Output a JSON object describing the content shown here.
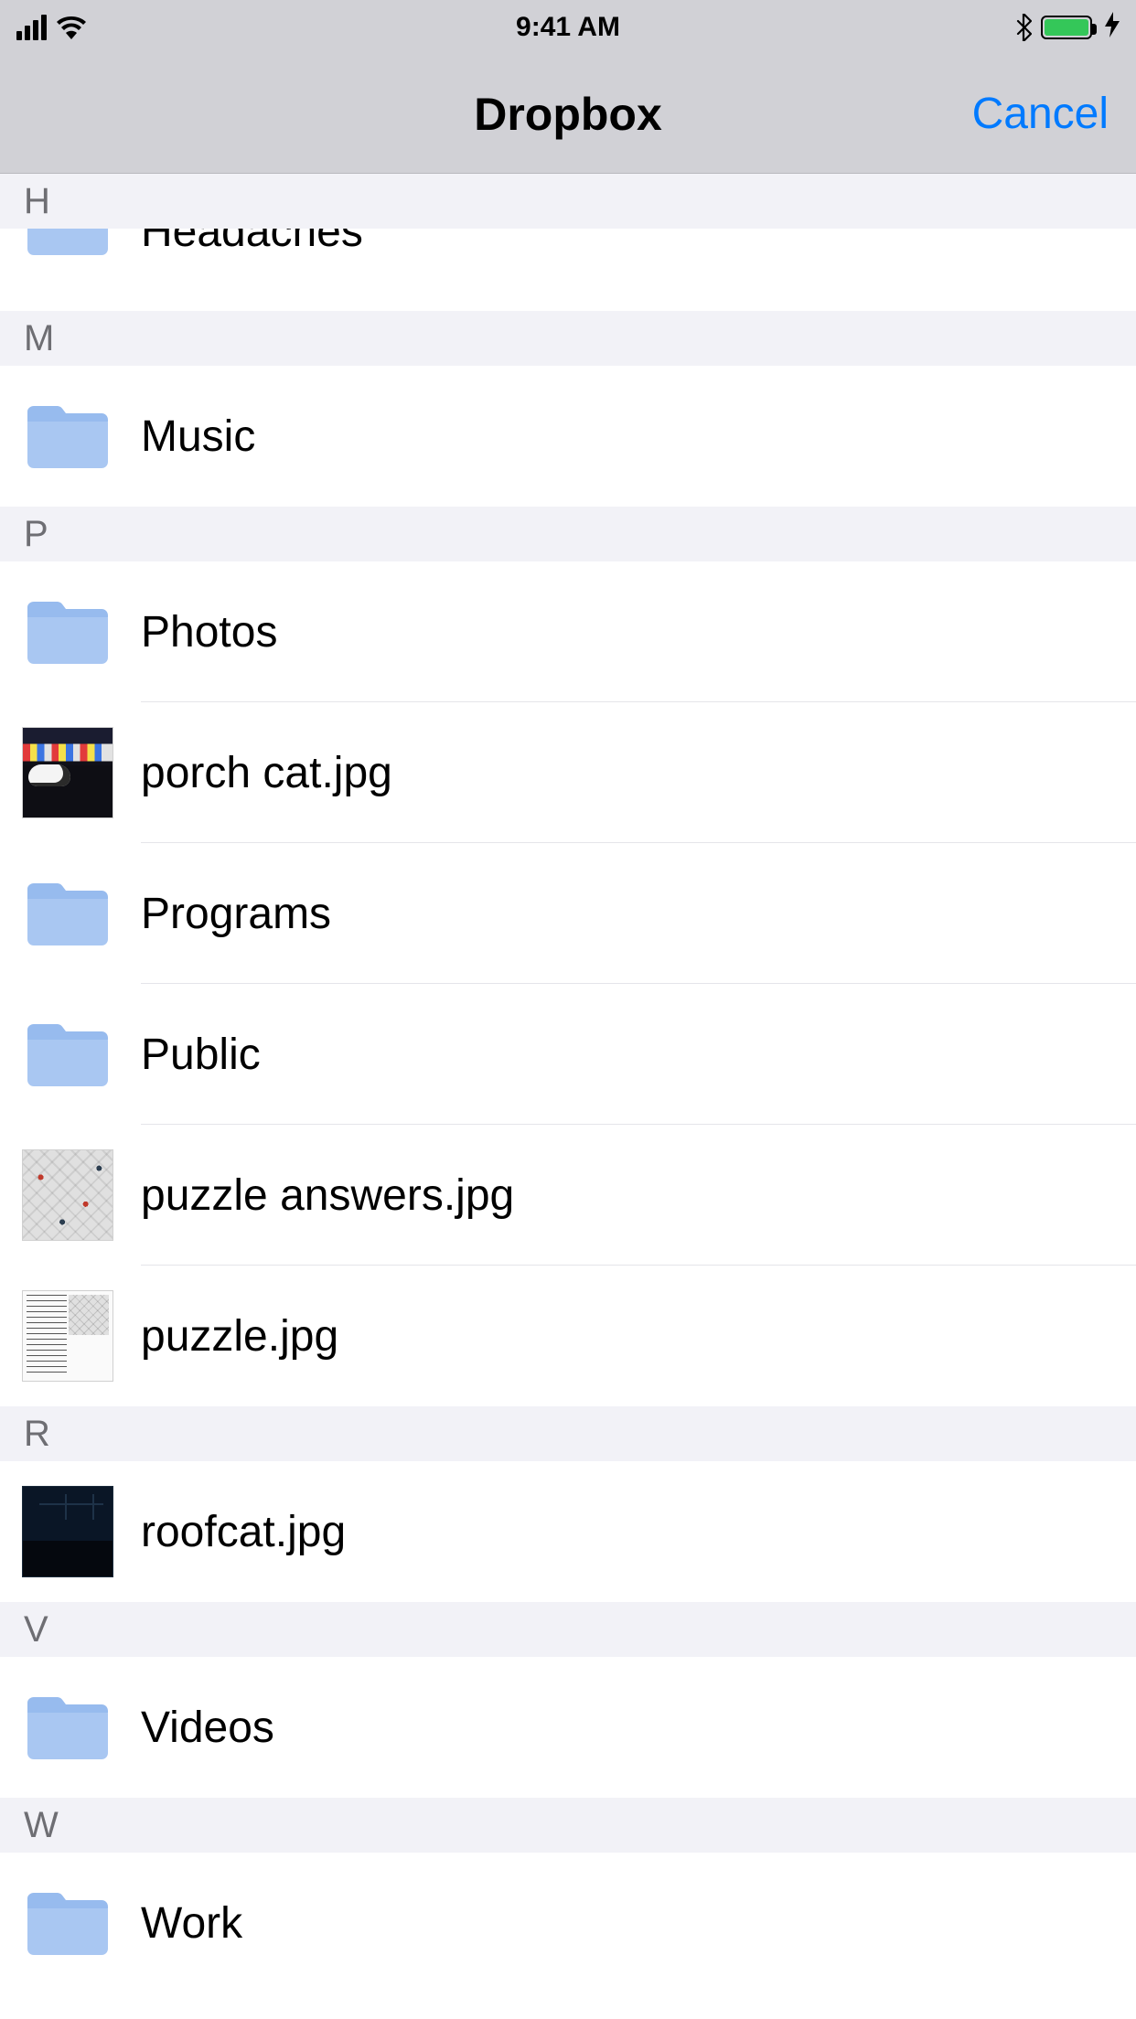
{
  "status": {
    "time": "9:41 AM"
  },
  "nav": {
    "title": "Dropbox",
    "cancel": "Cancel"
  },
  "sections": [
    {
      "letter": "H",
      "items": [
        {
          "name": "Headaches",
          "type": "folder",
          "partial": true
        }
      ]
    },
    {
      "letter": "M",
      "items": [
        {
          "name": "Music",
          "type": "folder"
        }
      ]
    },
    {
      "letter": "P",
      "items": [
        {
          "name": "Photos",
          "type": "folder"
        },
        {
          "name": "porch cat.jpg",
          "type": "image",
          "thumb": "porchcat"
        },
        {
          "name": "Programs",
          "type": "folder"
        },
        {
          "name": "Public",
          "type": "folder"
        },
        {
          "name": "puzzle answers.jpg",
          "type": "image",
          "thumb": "puzzle-ans"
        },
        {
          "name": "puzzle.jpg",
          "type": "image",
          "thumb": "puzzle"
        }
      ]
    },
    {
      "letter": "R",
      "items": [
        {
          "name": "roofcat.jpg",
          "type": "image",
          "thumb": "roofcat"
        }
      ]
    },
    {
      "letter": "V",
      "items": [
        {
          "name": "Videos",
          "type": "folder"
        }
      ]
    },
    {
      "letter": "W",
      "items": [
        {
          "name": "Work",
          "type": "folder"
        }
      ]
    }
  ]
}
